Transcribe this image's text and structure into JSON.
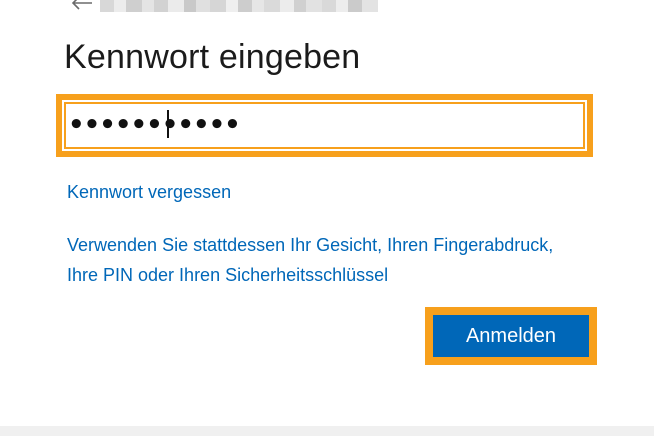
{
  "header": {
    "back_icon": "arrow-left-icon"
  },
  "title": "Kennwort eingeben",
  "password": {
    "masked_value": "•••••••••••"
  },
  "links": {
    "forgot": "Kennwort vergessen",
    "other_line1": "Verwenden Sie stattdessen Ihr Gesicht, Ihren Fingerabdruck,",
    "other_line2": "Ihre PIN oder Ihren Sicherheitsschlüssel"
  },
  "actions": {
    "sign_in": "Anmelden"
  },
  "colors": {
    "accent": "#0067b8",
    "highlight": "#f7a01c",
    "title": "#1b1b1b"
  }
}
